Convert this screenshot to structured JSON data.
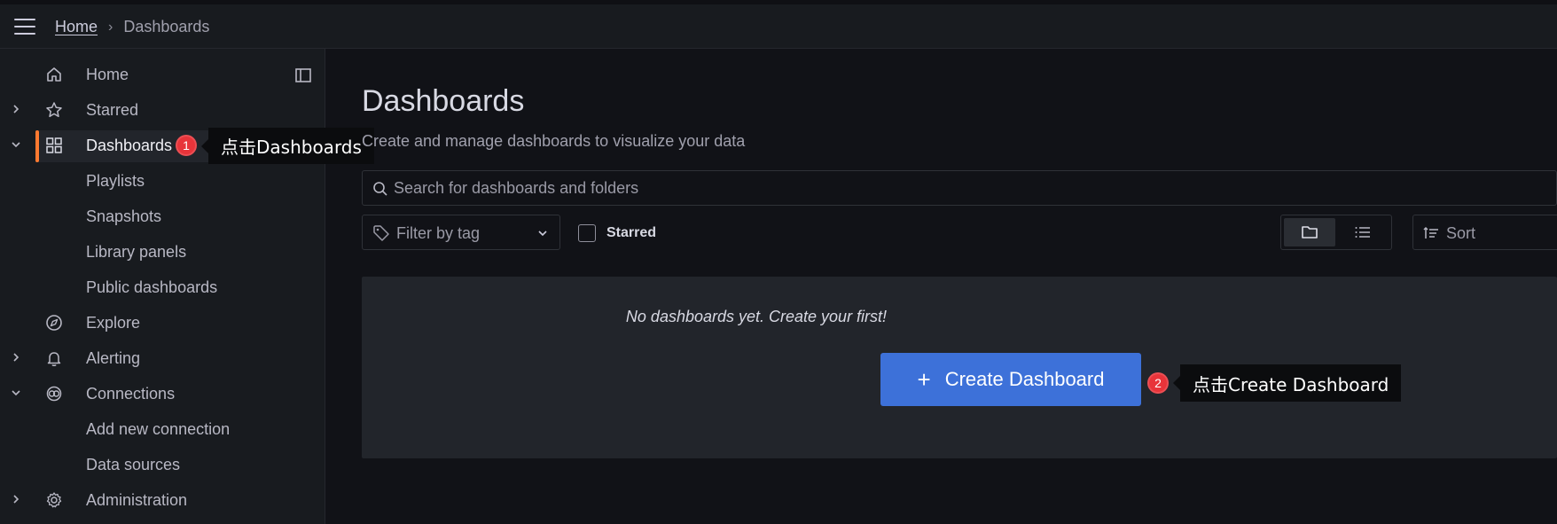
{
  "breadcrumb": {
    "home": "Home",
    "separator": "›",
    "current": "Dashboards"
  },
  "sidebar": {
    "items": [
      {
        "label": "Home",
        "icon": "home-icon",
        "chevron": ""
      },
      {
        "label": "Starred",
        "icon": "star-icon",
        "chevron": "right"
      },
      {
        "label": "Dashboards",
        "icon": "grid-icon",
        "chevron": "down",
        "active": true
      },
      {
        "label": "Playlists"
      },
      {
        "label": "Snapshots"
      },
      {
        "label": "Library panels"
      },
      {
        "label": "Public dashboards"
      },
      {
        "label": "Explore",
        "icon": "compass-icon",
        "chevron": ""
      },
      {
        "label": "Alerting",
        "icon": "bell-icon",
        "chevron": "right"
      },
      {
        "label": "Connections",
        "icon": "connections-icon",
        "chevron": "down"
      },
      {
        "label": "Add new connection"
      },
      {
        "label": "Data sources"
      },
      {
        "label": "Administration",
        "icon": "gear-icon",
        "chevron": "right"
      }
    ]
  },
  "main": {
    "title": "Dashboards",
    "subtitle": "Create and manage dashboards to visualize your data",
    "search_placeholder": "Search for dashboards and folders",
    "filter_label": "Filter by tag",
    "starred_label": "Starred",
    "sort_label": "Sort",
    "empty_text": "No dashboards yet. Create your first!",
    "create_label": "Create Dashboard"
  },
  "annotations": [
    {
      "number": "1",
      "text": "点击Dashboards"
    },
    {
      "number": "2",
      "text": "点击Create Dashboard"
    }
  ],
  "colors": {
    "accent_active": "#ff7a30",
    "primary_button": "#3d71d9",
    "badge": "#e8343a"
  }
}
